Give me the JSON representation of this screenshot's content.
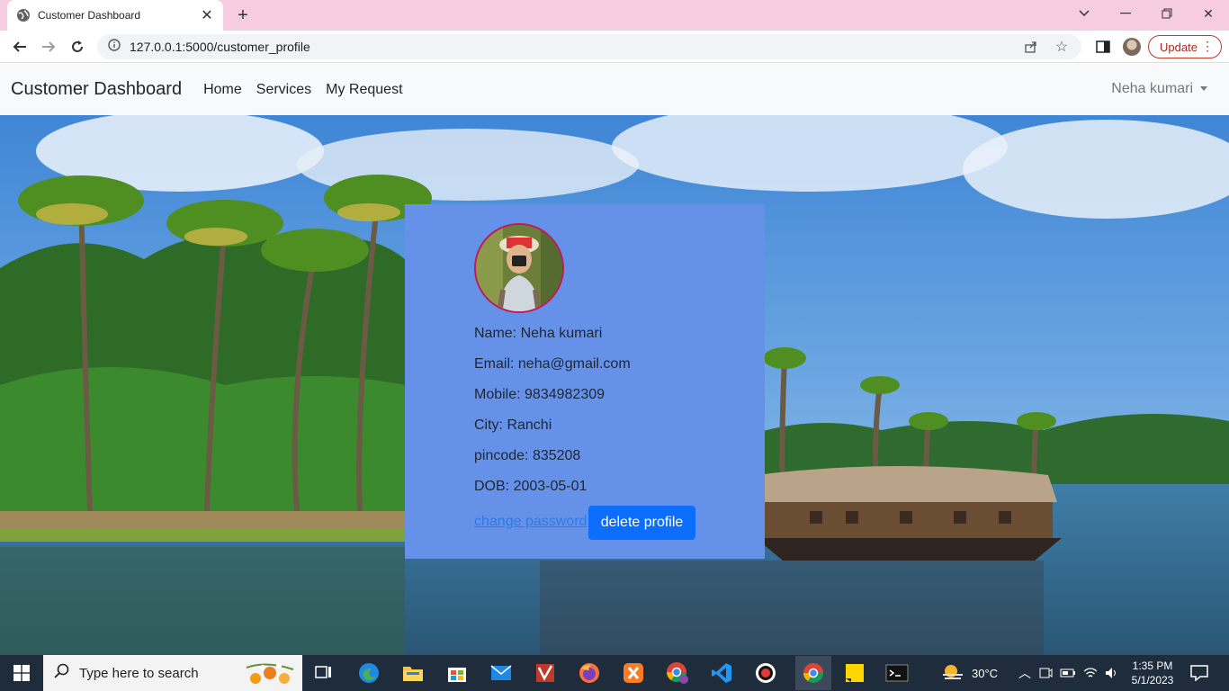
{
  "browser": {
    "tab_title": "Customer Dashboard",
    "url": "127.0.0.1:5000/customer_profile",
    "update_label": "Update"
  },
  "navbar": {
    "brand": "Customer Dashboard",
    "links": [
      "Home",
      "Services",
      "My Request"
    ],
    "user": "Neha kumari"
  },
  "profile": {
    "name": "Name: Neha kumari",
    "email": "Email: neha@gmail.com",
    "mobile": "Mobile: 9834982309",
    "city": "City: Ranchi",
    "pincode": "pincode: 835208",
    "dob": "DOB: 2003-05-01",
    "change_password": "change password",
    "delete_profile": "delete profile"
  },
  "taskbar": {
    "search_placeholder": "Type here to search",
    "weather": "30°C",
    "time": "1:35 PM",
    "date": "5/1/2023"
  },
  "colors": {
    "card_bg": "#6592e8",
    "primary": "#0d6efd",
    "tabbar_bg": "#f6cde0",
    "taskbar_bg": "#1f2c3c"
  }
}
